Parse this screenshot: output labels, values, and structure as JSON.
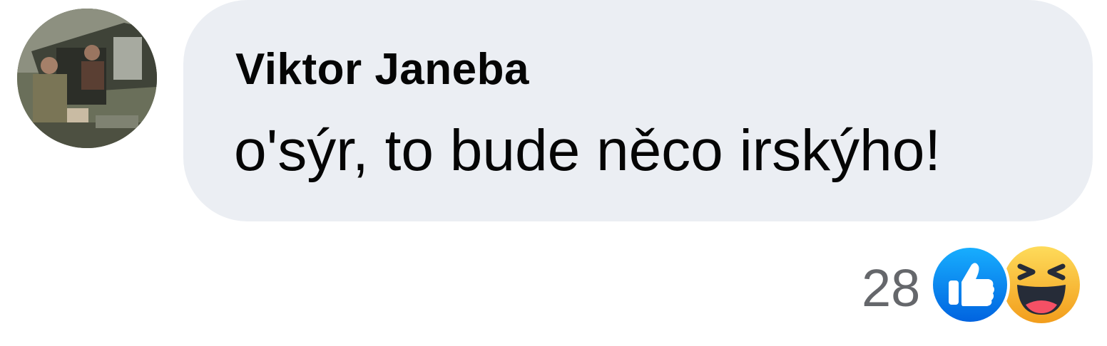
{
  "comment": {
    "author": "Viktor Janeba",
    "text": "o'sýr, to bude něco irskýho!"
  },
  "reactions": {
    "count": "28",
    "icons": [
      "like-icon",
      "haha-icon"
    ],
    "like_color": "#1877f2",
    "haha_color": "#f7b125"
  },
  "colors": {
    "bubble_background": "#ebeef3",
    "text": "#050505",
    "secondary_text": "#65676b"
  }
}
